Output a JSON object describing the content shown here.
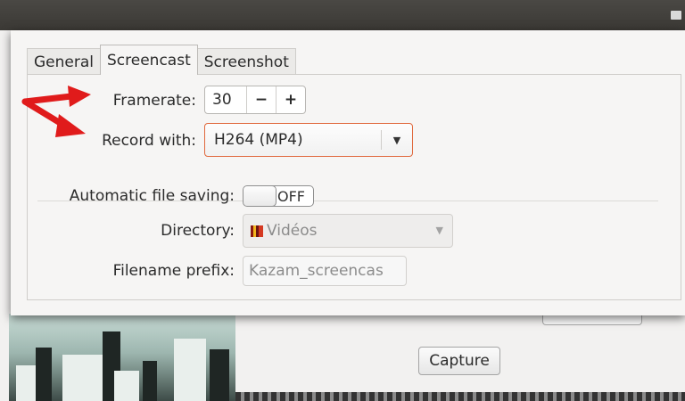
{
  "tabs": [
    {
      "label": "General",
      "active": false
    },
    {
      "label": "Screencast",
      "active": true
    },
    {
      "label": "Screenshot",
      "active": false
    }
  ],
  "framerate": {
    "label": "Framerate:",
    "value": "30",
    "decrement": "−",
    "increment": "+"
  },
  "record_with": {
    "label": "Record with:",
    "value": "H264 (MP4)"
  },
  "auto_save": {
    "label": "Automatic file saving:",
    "state": "OFF"
  },
  "directory": {
    "label": "Directory:",
    "value": "Vidéos"
  },
  "filename_prefix": {
    "label": "Filename prefix:",
    "value": "Kazam_screencas"
  },
  "main_window": {
    "capture_label": "Capture"
  },
  "colors": {
    "accent": "#e0683c",
    "annotation_arrow": "#e01b1b"
  },
  "icons": [
    "window-control-icon",
    "folder-icon",
    "dropdown-arrow-icon",
    "annotation-arrow-icon"
  ]
}
